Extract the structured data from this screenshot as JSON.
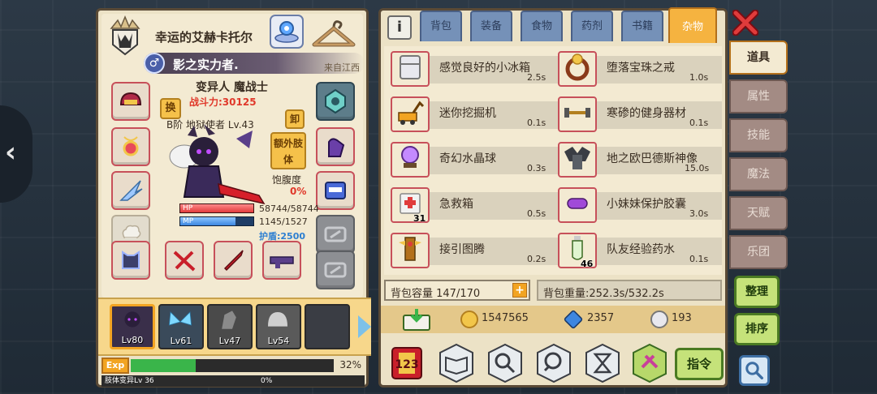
{
  "character": {
    "name": "幸运的艾赫卡托尔",
    "title": "影之实力者.",
    "origin": "来自江西",
    "class": "变异人 魔战士",
    "power": "战斗力:30125",
    "stage": "B阶 地狱使者 Lv.43",
    "swap_label": "换",
    "unload_label": "卸",
    "extra_limb_label": "额外肢体",
    "satiety_label": "饱腹度",
    "satiety_value": "0%",
    "hp_label": "HP",
    "hp_value": "58744/58744",
    "hp_fraction": 1.0,
    "mp_label": "MP",
    "mp_value": "1145/1527",
    "mp_fraction": 0.75,
    "shield": "护盾:2500"
  },
  "pets": [
    {
      "level": "Lv80",
      "selected": true
    },
    {
      "level": "Lv61",
      "selected": false
    },
    {
      "level": "Lv47",
      "selected": false
    },
    {
      "level": "Lv54",
      "selected": false
    },
    {
      "level": "",
      "selected": false
    }
  ],
  "exp": {
    "tag": "Exp",
    "percent": "32%",
    "fraction": 0.32,
    "limb_label": "肢体变异Lv 36",
    "limb_percent": "0%"
  },
  "inventory": {
    "tabs": [
      "背包",
      "装备",
      "食物",
      "药剂",
      "书籍",
      "杂物"
    ],
    "active_tab": "杂物",
    "items": [
      {
        "name": "感觉良好的小冰箱",
        "weight": "2.5s",
        "count": "",
        "icon": "fridge-icon"
      },
      {
        "name": "堕落宝珠之戒",
        "weight": "1.0s",
        "count": "",
        "icon": "ring-icon"
      },
      {
        "name": "迷你挖掘机",
        "weight": "0.1s",
        "count": "",
        "icon": "excavator-icon"
      },
      {
        "name": "寒碜的健身器材",
        "weight": "0.1s",
        "count": "",
        "icon": "dumbbell-icon"
      },
      {
        "name": "奇幻水晶球",
        "weight": "0.3s",
        "count": "",
        "icon": "crystal-ball-icon"
      },
      {
        "name": "地之欧巴德斯神像",
        "weight": "15.0s",
        "count": "",
        "icon": "statue-icon"
      },
      {
        "name": "急救箱",
        "weight": "0.5s",
        "count": "31",
        "icon": "first-aid-icon"
      },
      {
        "name": "小妹妹保护胶囊",
        "weight": "3.0s",
        "count": "",
        "icon": "capsule-icon"
      },
      {
        "name": "接引图腾",
        "weight": "0.2s",
        "count": "",
        "icon": "totem-icon"
      },
      {
        "name": "队友经验药水",
        "weight": "0.1s",
        "count": "46",
        "icon": "potion-icon"
      }
    ],
    "capacity": "背包容量 147/170",
    "weight": "背包重量:252.3s/532.2s",
    "gold": "1547565",
    "gems": "2357",
    "silver": "193",
    "command_label": "指令"
  },
  "side_tabs": [
    "道具",
    "属性",
    "技能",
    "魔法",
    "天赋",
    "乐团"
  ],
  "active_side_tab": "道具",
  "side_buttons": {
    "organize": "整理",
    "sort": "排序"
  }
}
